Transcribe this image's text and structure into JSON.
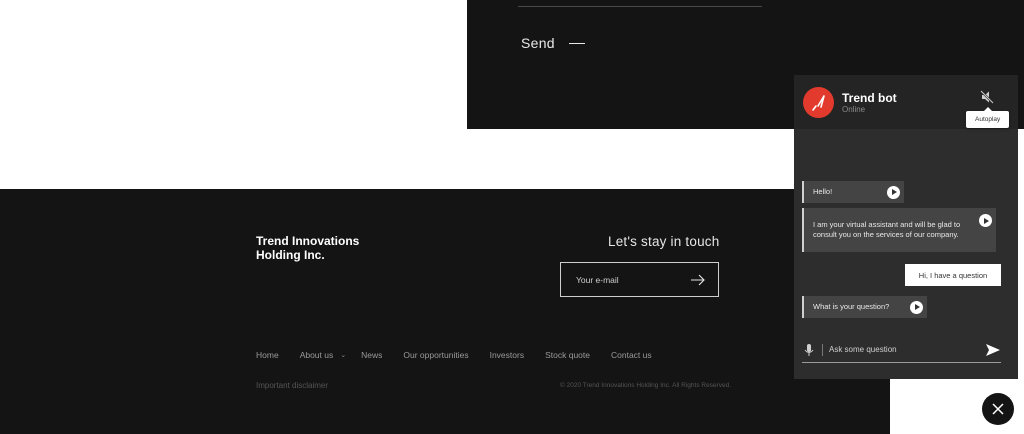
{
  "form": {
    "send_label": "Send"
  },
  "footer": {
    "brand": "Trend Innovations Holding Inc.",
    "stay_title": "Let's stay in touch",
    "email_placeholder": "Your e-mail",
    "nav": [
      {
        "label": "Home"
      },
      {
        "label": "About us",
        "has_dropdown": true
      },
      {
        "label": "News"
      },
      {
        "label": "Our opportunities"
      },
      {
        "label": "Investors"
      },
      {
        "label": "Stock quote"
      },
      {
        "label": "Contact us"
      }
    ],
    "disclaimer": "Important disclaimer",
    "copyright": "© 2020 Trend Innovations Holding Inc. All Rights Reserved."
  },
  "chat": {
    "bot_name": "Trend bot",
    "status": "Online",
    "tooltip": "Autoplay",
    "messages": [
      {
        "from": "bot",
        "text": "Hello!"
      },
      {
        "from": "bot",
        "text": "I am your virtual assistant and will be glad to consult you on the services of our company."
      },
      {
        "from": "user",
        "text": "Hi, I have a question"
      },
      {
        "from": "bot",
        "text": "What is your question?"
      }
    ],
    "input_placeholder": "Ask some question"
  },
  "colors": {
    "accent": "#e23a2c",
    "dark": "#141414",
    "chat_bg": "#2d2d2d"
  },
  "icons": [
    "mute-icon",
    "play-icon",
    "microphone-icon",
    "send-icon",
    "close-icon",
    "arrow-right-icon",
    "chevron-down-icon"
  ]
}
